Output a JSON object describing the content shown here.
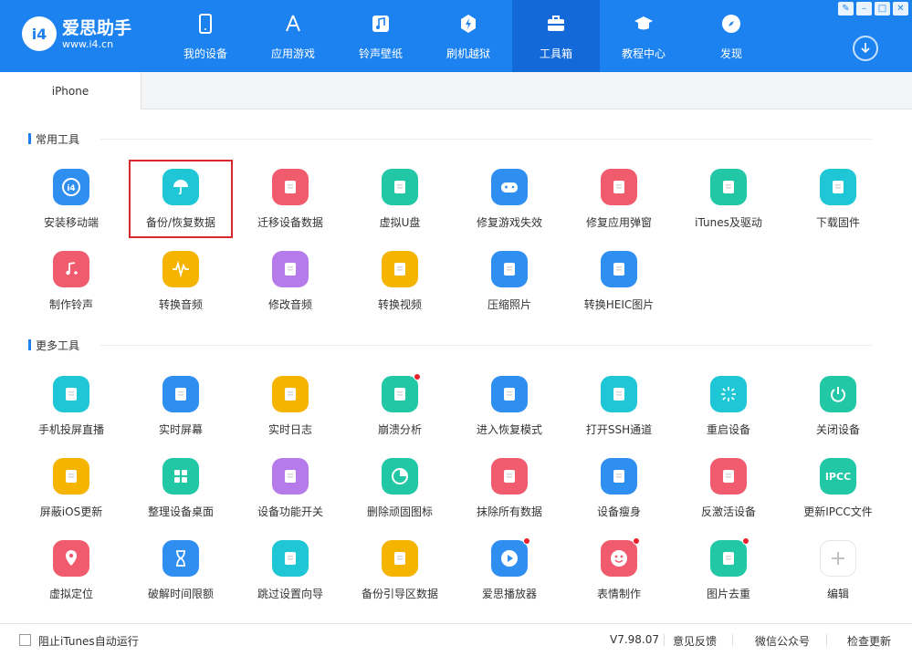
{
  "app": {
    "name": "爱思助手",
    "url": "www.i4.cn",
    "logo_mark": "i4"
  },
  "window_controls": [
    {
      "icon": "skin-icon",
      "glyph": "✎"
    },
    {
      "icon": "minimize-icon",
      "glyph": "–"
    },
    {
      "icon": "maximize-icon",
      "glyph": "□"
    },
    {
      "icon": "close-icon",
      "glyph": "✕"
    }
  ],
  "nav": [
    {
      "label": "我的设备",
      "icon": "phone-icon"
    },
    {
      "label": "应用游戏",
      "icon": "appstore-icon"
    },
    {
      "label": "铃声壁纸",
      "icon": "music-icon"
    },
    {
      "label": "刷机越狱",
      "icon": "flash-icon"
    },
    {
      "label": "工具箱",
      "icon": "toolbox-icon",
      "active": true
    },
    {
      "label": "教程中心",
      "icon": "graduation-cap-icon"
    },
    {
      "label": "发现",
      "icon": "compass-icon"
    }
  ],
  "tabs": [
    {
      "label": "iPhone"
    }
  ],
  "sections": {
    "common": {
      "title": "常用工具",
      "tools": [
        {
          "label": "安装移动端",
          "icon": "i4-app-icon",
          "color": "#2F8FF0"
        },
        {
          "label": "备份/恢复数据",
          "icon": "umbrella-icon",
          "color": "#1FC7D6",
          "highlighted": true
        },
        {
          "label": "迁移设备数据",
          "icon": "migrate-icon",
          "color": "#F05B6E"
        },
        {
          "label": "虚拟U盘",
          "icon": "usb-drive-icon",
          "color": "#22C7A6"
        },
        {
          "label": "修复游戏失效",
          "icon": "gamepad-icon",
          "color": "#2F8FF0"
        },
        {
          "label": "修复应用弹窗",
          "icon": "repair-window-icon",
          "color": "#F05B6E"
        },
        {
          "label": "iTunes及驱动",
          "icon": "itunes-icon",
          "color": "#22C7A6"
        },
        {
          "label": "下载固件",
          "icon": "firmware-download-icon",
          "color": "#1FC7D6"
        },
        {
          "label": "制作铃声",
          "icon": "ringtone-icon",
          "color": "#F05B6E"
        },
        {
          "label": "转换音频",
          "icon": "audio-wave-icon",
          "color": "#F5B400"
        },
        {
          "label": "修改音频",
          "icon": "audio-edit-icon",
          "color": "#B57BEA"
        },
        {
          "label": "转换视频",
          "icon": "video-convert-icon",
          "color": "#F5B400"
        },
        {
          "label": "压缩照片",
          "icon": "photo-compress-icon",
          "color": "#2F8FF0"
        },
        {
          "label": "转换HEIC图片",
          "icon": "heic-convert-icon",
          "color": "#2F8FF0"
        }
      ]
    },
    "more": {
      "title": "更多工具",
      "tools": [
        {
          "label": "手机投屏直播",
          "icon": "screen-cast-icon",
          "color": "#1FC7D6"
        },
        {
          "label": "实时屏幕",
          "icon": "live-screen-icon",
          "color": "#2F8FF0"
        },
        {
          "label": "实时日志",
          "icon": "log-icon",
          "color": "#F5B400"
        },
        {
          "label": "崩溃分析",
          "icon": "crash-analysis-icon",
          "color": "#22C7A6",
          "badge": true
        },
        {
          "label": "进入恢复模式",
          "icon": "recovery-mode-icon",
          "color": "#2F8FF0"
        },
        {
          "label": "打开SSH通道",
          "icon": "ssh-terminal-icon",
          "color": "#1FC7D6"
        },
        {
          "label": "重启设备",
          "icon": "restart-icon",
          "color": "#1FC7D6"
        },
        {
          "label": "关闭设备",
          "icon": "power-icon",
          "color": "#22C7A6"
        },
        {
          "label": "屏蔽iOS更新",
          "icon": "block-update-icon",
          "color": "#F5B400"
        },
        {
          "label": "整理设备桌面",
          "icon": "grid-icon",
          "color": "#22C7A6"
        },
        {
          "label": "设备功能开关",
          "icon": "toggle-icon",
          "color": "#B57BEA"
        },
        {
          "label": "删除顽固图标",
          "icon": "pie-delete-icon",
          "color": "#22C7A6"
        },
        {
          "label": "抹除所有数据",
          "icon": "eraser-icon",
          "color": "#F05B6E"
        },
        {
          "label": "设备瘦身",
          "icon": "broom-icon",
          "color": "#2F8FF0"
        },
        {
          "label": "反激活设备",
          "icon": "deactivate-icon",
          "color": "#F05B6E"
        },
        {
          "label": "更新IPCC文件",
          "icon": "ipcc-icon",
          "color": "#22C7A6",
          "text": "IPCC"
        },
        {
          "label": "虚拟定位",
          "icon": "location-pin-icon",
          "color": "#F05B6E"
        },
        {
          "label": "破解时间限额",
          "icon": "hourglass-icon",
          "color": "#2F8FF0"
        },
        {
          "label": "跳过设置向导",
          "icon": "skip-setup-icon",
          "color": "#1FC7D6"
        },
        {
          "label": "备份引导区数据",
          "icon": "folder-backup-icon",
          "color": "#F5B400"
        },
        {
          "label": "爱思播放器",
          "icon": "play-icon",
          "color": "#2F8FF0",
          "badge": true
        },
        {
          "label": "表情制作",
          "icon": "emoji-icon",
          "color": "#F05B6E",
          "badge": true
        },
        {
          "label": "图片去重",
          "icon": "image-dedupe-icon",
          "color": "#22C7A6",
          "badge": true
        },
        {
          "label": "编辑",
          "icon": "plus-icon",
          "color": "#FFFFFF",
          "plain": true
        }
      ]
    }
  },
  "footer": {
    "checkbox_label": "阻止iTunes自动运行",
    "checked": false,
    "version": "V7.98.07",
    "feedback": "意见反馈",
    "wechat": "微信公众号",
    "update": "检查更新"
  }
}
